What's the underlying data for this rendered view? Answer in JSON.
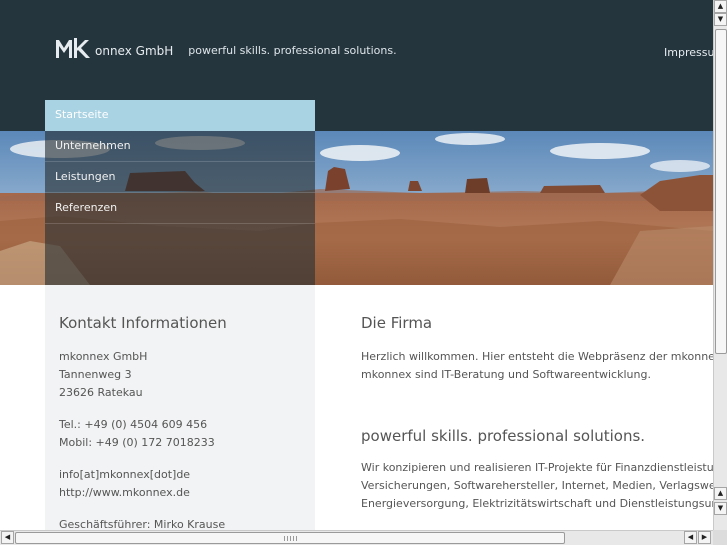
{
  "header": {
    "logo_text": "onnex GmbH",
    "logo_mark_letters": "mk",
    "tagline": "powerful skills. professional solutions.",
    "impressum_link": "Impressum"
  },
  "nav": {
    "items": [
      {
        "label": "Startseite",
        "active": true
      },
      {
        "label": "Unternehmen",
        "active": false
      },
      {
        "label": "Leistungen",
        "active": false
      },
      {
        "label": "Referenzen",
        "active": false
      }
    ]
  },
  "sidebar": {
    "title": "Kontakt Informationen",
    "company": "mkonnex GmbH",
    "street": "Tannenweg 3",
    "city": "23626 Ratekau",
    "tel": "Tel.: +49 (0) 4504 609 456",
    "mobil": "Mobil: +49 (0) 172 7018233",
    "email": "info[at]mkonnex[dot]de",
    "web": "http://www.mkonnex.de",
    "ceo": "Geschäftsführer: Mirko Krause"
  },
  "main": {
    "heading": "Die Firma",
    "intro_line1": "Herzlich willkommen. Hier entsteht die Webpräsenz der mkonnex GmbH",
    "intro_line2": "mkonnex sind IT-Beratung und Softwareentwicklung.",
    "subheading": "powerful skills. professional solutions.",
    "body_line1": "Wir konzipieren und realisieren IT-Projekte für Finanzdienstleistungsunt",
    "body_line2": "Versicherungen, Softwarehersteller, Internet, Medien, Verlagswesen, M",
    "body_line3": "Energieversorgung, Elektrizitätswirtschaft und Dienstleistungsunternehm"
  },
  "scrollbars": {
    "up_icon": "arrow-up-icon",
    "down_icon": "arrow-down-icon",
    "left_icon": "arrow-left-icon",
    "right_icon": "arrow-right-icon"
  },
  "colors": {
    "header_bg": "#25353d",
    "nav_active": "#a9d2e3",
    "sidebar_bg": "#f2f3f4",
    "text": "#555555"
  }
}
